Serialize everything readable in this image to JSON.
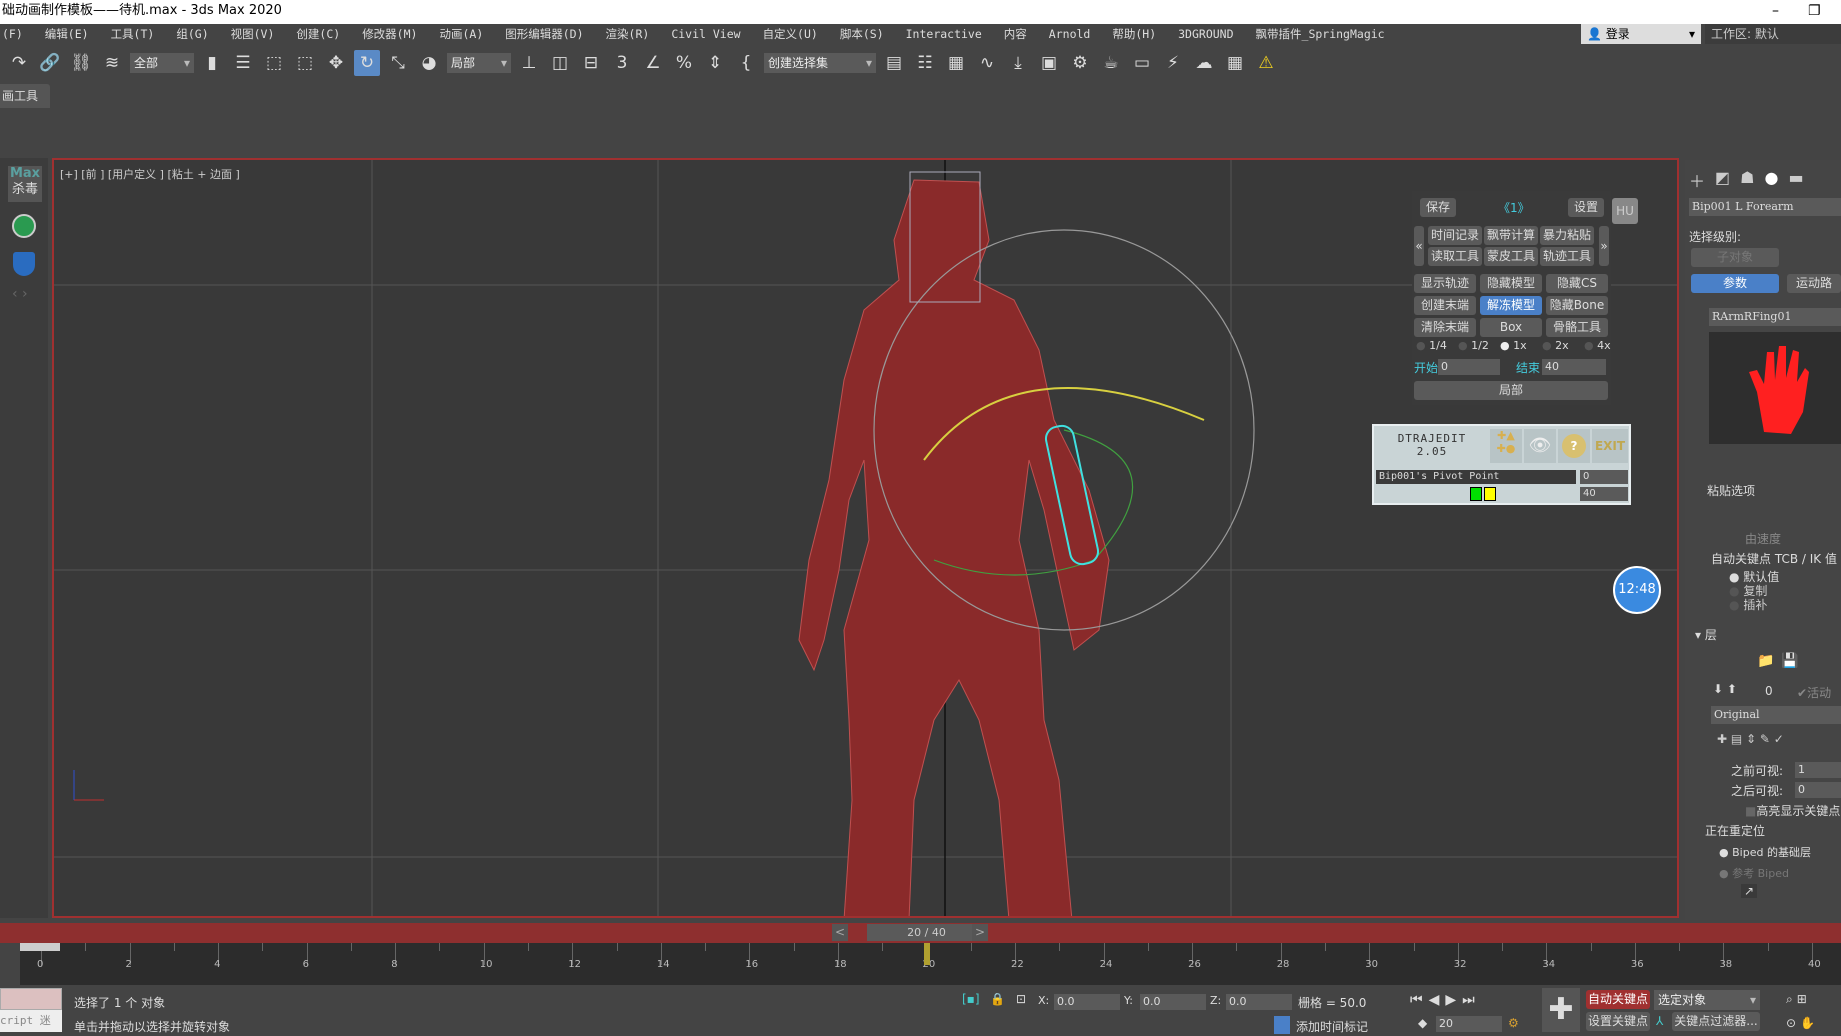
{
  "window": {
    "title": "础动画制作模板——待机.max - 3ds Max 2020",
    "minimize": "–",
    "restore": "❐"
  },
  "menu": [
    "(F)",
    "编辑(E)",
    "工具(T)",
    "组(G)",
    "视图(V)",
    "创建(C)",
    "修改器(M)",
    "动画(A)",
    "图形编辑器(D)",
    "渲染(R)",
    "Civil View",
    "自定义(U)",
    "脚本(S)",
    "Interactive",
    "内容",
    "Arnold",
    "帮助(H)",
    "3DGROUND",
    "飘带插件_SpringMagic"
  ],
  "account": {
    "login": "登录",
    "workspace_label": "工作区:",
    "workspace_value": "默认"
  },
  "toolbar": {
    "selection_filter": "全部",
    "coord_system": "局部",
    "named_selection": "创建选择集",
    "icons": [
      "redo-icon",
      "link-icon",
      "unlink-icon",
      "bind-spacewarp-icon",
      "select-object-icon",
      "select-by-name-icon",
      "rect-selection-icon",
      "window-crossing-icon",
      "move-icon",
      "rotate-icon",
      "scale-icon",
      "placement-icon",
      "pivot-icon",
      "mirror-icon",
      "align-icon",
      "snap-3d-icon",
      "angle-snap-icon",
      "percent-snap-icon",
      "spinner-snap-icon",
      "edit-named-selection-icon",
      "toggle-scene-explorer-icon",
      "layer-explorer-icon",
      "ribbon-icon",
      "curve-editor-icon",
      "dope-sheet-icon",
      "schematic-icon",
      "material-editor-icon",
      "render-setup-icon",
      "rendered-frame-icon",
      "render-icon",
      "render-cloud-icon",
      "viewport-layout-icon",
      "warning-icon"
    ]
  },
  "ribbon": {
    "tab": "画工具"
  },
  "left_strip": {
    "max_label": "Max",
    "antivirus_label": "杀毒"
  },
  "viewport": {
    "label": "[+] [前 ] [用户定义 ] [粘土 + 边面 ]"
  },
  "float_panel": {
    "save": "保存",
    "page": "《1》",
    "settings": "设置",
    "prev": "«",
    "next": "»",
    "hu": "HU",
    "row1": [
      "时间记录",
      "飘带计算",
      "暴力粘贴"
    ],
    "row2": [
      "读取工具",
      "蒙皮工具",
      "轨迹工具"
    ],
    "grid": [
      [
        "显示轨迹",
        "隐藏模型",
        "隐藏CS"
      ],
      [
        "创建末端",
        "解冻模型",
        "隐藏Bone"
      ],
      [
        "清除末端",
        "Box",
        "骨骼工具"
      ]
    ],
    "active_button": "解冻模型",
    "speeds": [
      "1/4",
      "1/2",
      "1x",
      "2x",
      "4x"
    ],
    "selected_speed": "1x",
    "start_label": "开始",
    "start_value": "0",
    "end_label": "结束",
    "end_value": "40",
    "local": "局部"
  },
  "dtraj": {
    "name": "DTRAJEDIT",
    "version": "2.05",
    "exit": "EXIT",
    "help": "?",
    "object": "Bip001's Pivot Point",
    "value1": "0",
    "value2": "40",
    "colors": [
      "#00e000",
      "#ffff00"
    ]
  },
  "clock": {
    "time": "12:48"
  },
  "command_panel": {
    "object_name": "Bip001 L Forearm",
    "selection_level": "选择级别:",
    "sub_object": "子对象",
    "params": "参数",
    "motion_path": "运动路",
    "hand_select": "RArmRFing01",
    "paste_options": "粘贴选项",
    "by_velocity": "由速度",
    "auto_key_tcb": "自动关键点 TCB / IK 值",
    "auto_key_options": [
      "默认值",
      "复制",
      "插补"
    ],
    "layers_title": "层",
    "layer_index": "0",
    "active": "活动",
    "layer_name": "Original",
    "before_visible_label": "之前可视:",
    "before_visible": "1",
    "after_visible_label": "之后可视:",
    "after_visible": "0",
    "highlight_keys": "高亮显示关键点",
    "retargeting": "正在重定位",
    "biped_base": "Biped 的基础层",
    "ref_biped": "参考 Biped"
  },
  "time_slider": {
    "label": "20 / 40",
    "prev": "<",
    "next": ">",
    "current": 20,
    "start": 0,
    "end": 40
  },
  "timeline": {
    "ticks": [
      "0",
      "2",
      "4",
      "6",
      "8",
      "10",
      "12",
      "14",
      "16",
      "18",
      "20",
      "22",
      "24",
      "26",
      "28",
      "30",
      "32",
      "34",
      "36",
      "38",
      "40"
    ]
  },
  "status": {
    "selected": "选择了 1 个 对象",
    "hint": "单击并拖动以选择并旋转对象",
    "script": "cript 迷",
    "x_label": "X:",
    "x": "0.0",
    "y_label": "Y:",
    "y": "0.0",
    "z_label": "Z:",
    "z": "0.0",
    "grid": "栅格 = 50.0",
    "add_time_tag": "添加时间标记",
    "frame": "20",
    "auto_key": "自动关键点",
    "set_key": "设置关键点",
    "selected_object": "选定对象",
    "key_filters": "关键点过滤器..."
  }
}
